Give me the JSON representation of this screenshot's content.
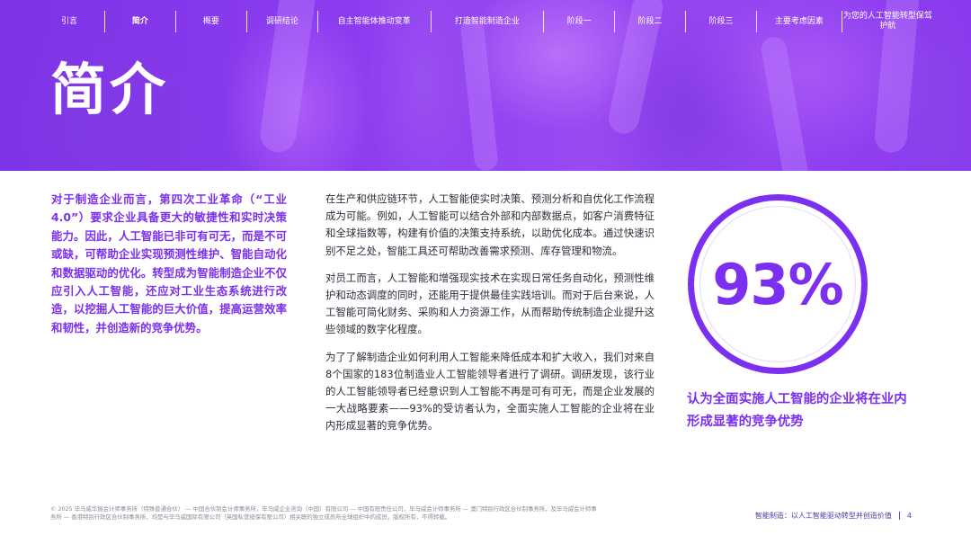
{
  "nav": {
    "items": [
      {
        "label": "引言",
        "active": false
      },
      {
        "label": "简介",
        "active": true
      },
      {
        "label": "概要",
        "active": false
      },
      {
        "label": "调研结论",
        "active": false
      },
      {
        "label": "自主智能体推动变革",
        "active": false
      },
      {
        "label": "打造智能制造企业",
        "active": false
      },
      {
        "label": "阶段一",
        "active": false
      },
      {
        "label": "阶段二",
        "active": false
      },
      {
        "label": "阶段三",
        "active": false
      },
      {
        "label": "主要考虑因素",
        "active": false
      },
      {
        "label": "为您的人工智能转型保驾护航",
        "active": false
      }
    ]
  },
  "hero": {
    "title": "简介"
  },
  "lead": {
    "text": "对于制造企业而言，第四次工业革命（“工业4.0”）要求企业具备更大的敏捷性和实时决策能力。因此，人工智能已非可有可无，而是不可或缺，可帮助企业实现预测性维护、智能自动化和数据驱动的优化。转型成为智能制造企业不仅应引入人工智能，还应对工业生态系统进行改造，以挖掘人工智能的巨大价值，提高运营效率和韧性，并创造新的竞争优势。"
  },
  "body": {
    "paragraphs": [
      "在生产和供应链环节，人工智能使实时决策、预测分析和自优化工作流程成为可能。例如，人工智能可以结合外部和内部数据点，如客户消费特征和全球指数等，构建有价值的决策支持系统，以助优化成本。通过快速识别不足之处，智能工具还可帮助改善需求预测、库存管理和物流。",
      "对员工而言，人工智能和增强现实技术在实现日常任务自动化，预测性维护和动态调度的同时，还能用于提供最佳实践培训。而对于后台来说，人工智能可简化财务、采购和人力资源工作，从而帮助传统制造企业提升这些领域的数字化程度。",
      "为了了解制造企业如何利用人工智能来降低成本和扩大收入，我们对来自8个国家的183位制造业人工智能领导者进行了调研。调研发现，该行业的人工智能领导者已经意识到人工智能不再是可有可无，而是企业发展的一大战略要素——93%的受访者认为，全面实施人工智能的企业将在业内形成显著的竞争优势。"
    ]
  },
  "stat": {
    "value": "93%",
    "caption": "认为全面实施人工智能的企业将在业内形成显著的竞争优势"
  },
  "footer": {
    "legal": "© 2025 毕马威华振会计师事务所（特殊普通合伙） — 中国合伙制会计师事务所，毕马威企业咨询（中国）有限公司 — 中国有限责任公司，毕马威会计师事务所 — 澳门特别行政区合伙制事务所，及毕马威会计师事务所 — 香港特别行政区合伙制事务所，均是与毕马威国际有限公司（英国私营担保有限公司）相关联的独立成员所全球组织中的成员。版权所有，不得转载。",
    "doc_title": "智能制造：以人工智能驱动转型并创造价值",
    "page_number": "4"
  },
  "colors": {
    "accent": "#7b2ff0",
    "hero_bg": "#8c3cef",
    "body_text": "#2d2d3a",
    "footer_text": "#8a8a96"
  }
}
